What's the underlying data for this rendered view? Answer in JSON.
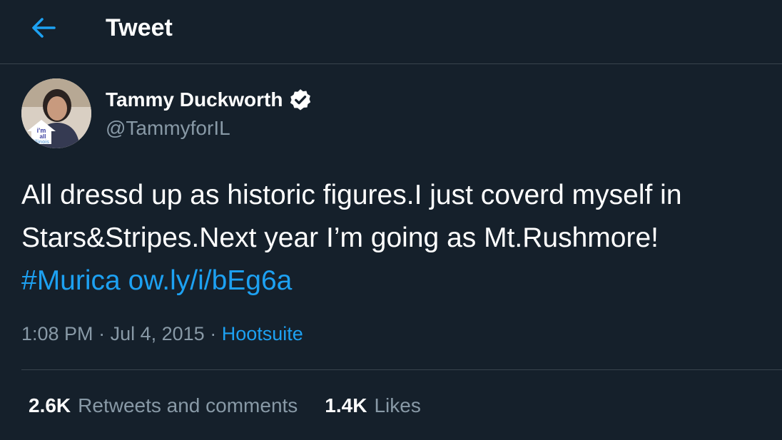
{
  "header": {
    "back_icon": "arrow-left-icon",
    "title": "Tweet"
  },
  "author": {
    "name": "Tammy Duckworth",
    "handle": "@TammyforIL",
    "verified_icon": "verified-badge-icon",
    "avatar_badge_text": [
      "i'm",
      "all",
      "illinois"
    ]
  },
  "tweet": {
    "line1": "All dressd up as historic figures.I just coverd myself in",
    "line2": "Stars&Stripes.Next year I’m going as Mt.Rushmore!",
    "hashtag": "#Murica",
    "link": "ow.ly/i/bEg6a"
  },
  "meta": {
    "time": "1:08 PM",
    "separator": "·",
    "date": "Jul 4, 2015",
    "source": "Hootsuite"
  },
  "stats": {
    "retweets_count": "2.6K",
    "retweets_label": "Retweets and comments",
    "likes_count": "1.4K",
    "likes_label": "Likes"
  },
  "colors": {
    "background": "#15202b",
    "accent": "#1da1f2",
    "secondary_text": "#8899a6",
    "divider": "#38444d"
  }
}
